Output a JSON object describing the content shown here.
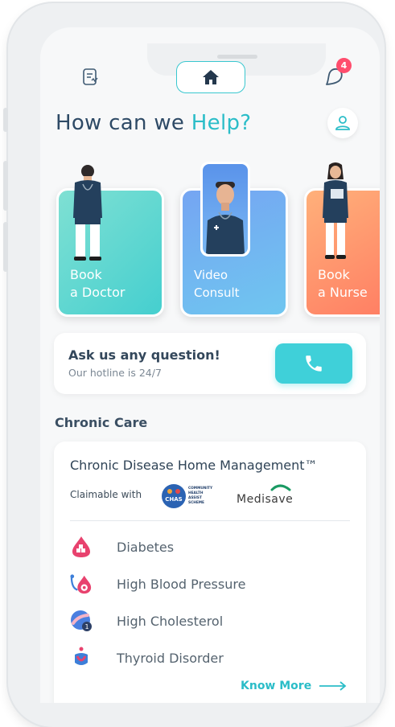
{
  "header": {
    "notification_count": "4",
    "title_main": "How can we ",
    "title_accent": "Help?"
  },
  "services": [
    {
      "line1": "Book",
      "line2": "a Doctor"
    },
    {
      "line1": "Video",
      "line2": "Consult"
    },
    {
      "line1": "Book",
      "line2": "a Nurse"
    }
  ],
  "hotline": {
    "title": "Ask us any question!",
    "subtitle": "Our hotline is 24/7"
  },
  "chronic": {
    "section_title": "Chronic Care",
    "card_title": "Chronic Disease Home Management™",
    "claimable": "Claimable with",
    "chas_label": "CHAS",
    "chas_sub1": "COMMUNITY",
    "chas_sub2": "HEALTH",
    "chas_sub3": "ASSIST",
    "chas_sub4": "SCHEME",
    "medisave": "Medisave",
    "conditions": [
      {
        "name": "Diabetes",
        "icon": "diabetes-icon"
      },
      {
        "name": "High Blood Pressure",
        "icon": "blood-pressure-icon"
      },
      {
        "name": "High Cholesterol",
        "icon": "cholesterol-icon"
      },
      {
        "name": "Thyroid Disorder",
        "icon": "thyroid-icon"
      }
    ],
    "know_more": "Know More"
  },
  "colors": {
    "accent": "#2bbdc8",
    "title": "#2e4a66",
    "badge": "#ff4d6d"
  }
}
